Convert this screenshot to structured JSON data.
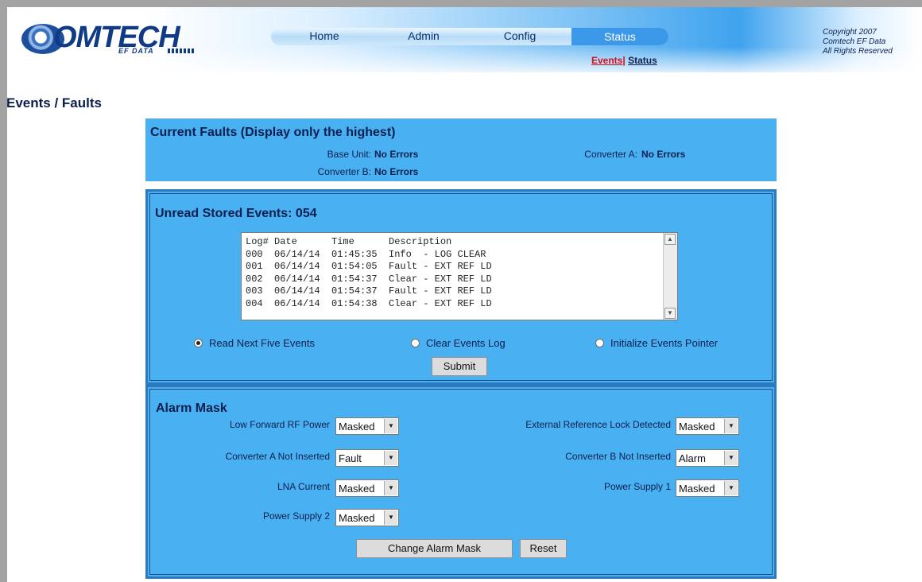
{
  "header": {
    "logo": {
      "brand": "OMTECH",
      "sub": "EF DATA"
    },
    "nav": [
      {
        "label": "Home"
      },
      {
        "label": "Admin"
      },
      {
        "label": "Config"
      },
      {
        "label": "Status"
      }
    ],
    "active_nav": "Status",
    "subnav": {
      "events": "Events",
      "separator": "|",
      "status": "Status"
    },
    "copyright": [
      "Copyright 2007",
      "Comtech EF Data",
      "All Rights Reserved"
    ]
  },
  "page_title": "Events / Faults",
  "current_faults": {
    "heading": "Current Faults (Display only the highest)",
    "items": [
      {
        "label": "Base Unit:",
        "value": "No Errors"
      },
      {
        "label": "Converter A:",
        "value": "No Errors"
      },
      {
        "label": "Converter B:",
        "value": "No Errors"
      }
    ]
  },
  "stored_events": {
    "heading": "Unread Stored Events: 054",
    "log_header": "Log# Date      Time      Description",
    "log_rows": [
      "000  06/14/14  01:45:35  Info  - LOG CLEAR",
      "001  06/14/14  01:54:05  Fault - EXT REF LD",
      "002  06/14/14  01:54:37  Clear - EXT REF LD",
      "003  06/14/14  01:54:37  Fault - EXT REF LD",
      "004  06/14/14  01:54:38  Clear - EXT REF LD"
    ],
    "options": [
      {
        "label": "Read Next Five Events",
        "checked": true
      },
      {
        "label": "Clear Events Log",
        "checked": false
      },
      {
        "label": "Initialize Events Pointer",
        "checked": false
      }
    ],
    "submit_label": "Submit"
  },
  "alarm_mask": {
    "heading": "Alarm Mask",
    "items": [
      {
        "label": "Low Forward RF Power",
        "value": "Masked"
      },
      {
        "label": "External Reference Lock Detected",
        "value": "Masked"
      },
      {
        "label": "Converter A Not Inserted",
        "value": "Fault"
      },
      {
        "label": "Converter B Not Inserted",
        "value": "Alarm"
      },
      {
        "label": "LNA Current",
        "value": "Masked"
      },
      {
        "label": "Power Supply 1",
        "value": "Masked"
      },
      {
        "label": "Power Supply 2",
        "value": "Masked"
      }
    ],
    "change_label": "Change Alarm Mask",
    "reset_label": "Reset"
  },
  "colors": {
    "panel": "#49b1f1",
    "panel_border": "#2b79bf",
    "text_dark": "#0b1e4f",
    "link_active": "#d0101a"
  }
}
